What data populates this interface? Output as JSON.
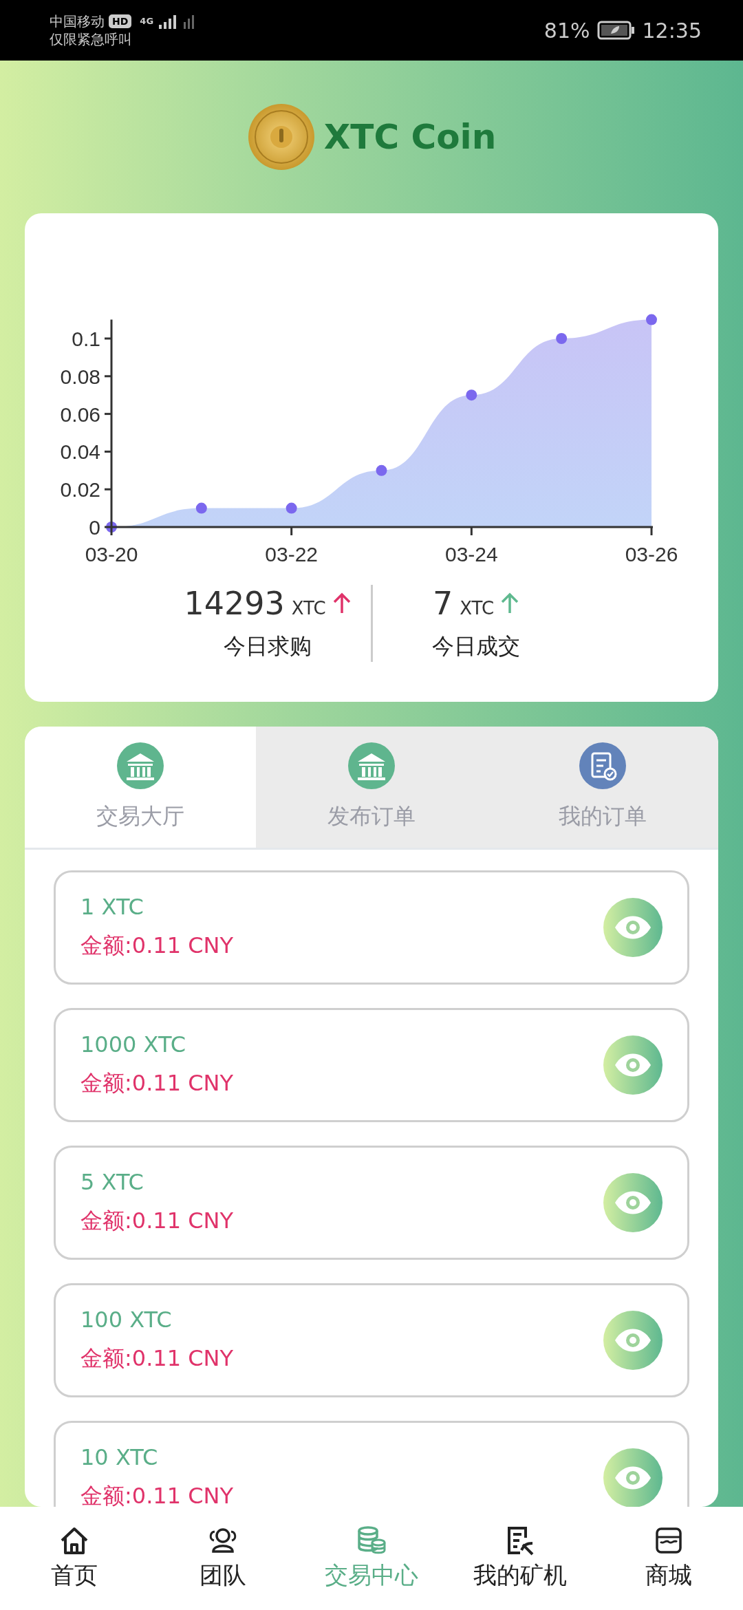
{
  "status_bar": {
    "carrier": "中国移动",
    "hd": "HD",
    "network": "4G",
    "emergency": "仅限紧急呼叫",
    "battery": "81%",
    "time": "12:35"
  },
  "header": {
    "title": "XTC Coin"
  },
  "chart": {
    "chart_data": {
      "type": "area",
      "categories": [
        "03-20",
        null,
        "03-22",
        null,
        "03-24",
        null,
        "03-26"
      ],
      "series": [
        {
          "color": "#7b68ee",
          "values": [
            0,
            0.01,
            0.01,
            0.03,
            0.07,
            0.1,
            0.11
          ]
        }
      ],
      "yticks": [
        {
          "value": 0,
          "label": "0"
        },
        {
          "value": 0.02,
          "label": "0.02"
        },
        {
          "value": 0.04,
          "label": "0.04"
        },
        {
          "value": 0.06,
          "label": "0.06"
        },
        {
          "value": 0.08,
          "label": "0.08"
        },
        {
          "value": 0.1,
          "label": "0.1"
        }
      ],
      "ylim": [
        0,
        0.11
      ]
    }
  },
  "stats": [
    {
      "value": "14293",
      "unit": "XTC",
      "label": "今日求购",
      "color": "#e0336a"
    },
    {
      "value": "7",
      "unit": "XTC",
      "label": "今日成交",
      "color": "#5fb98f"
    }
  ],
  "tabs": [
    {
      "label": "交易大厅",
      "selected": true,
      "kind": "bank",
      "color": "#5fb58e"
    },
    {
      "label": "发布订单",
      "selected": false,
      "kind": "bank",
      "color": "#5fb58e"
    },
    {
      "label": "我的订单",
      "selected": false,
      "kind": "document",
      "color": "#6283ba"
    }
  ],
  "orders": [
    {
      "amount": "1 XTC",
      "price": "金额:0.11 CNY"
    },
    {
      "amount": "1000 XTC",
      "price": "金额:0.11 CNY"
    },
    {
      "amount": "5 XTC",
      "price": "金额:0.11 CNY"
    },
    {
      "amount": "100 XTC",
      "price": "金额:0.11 CNY"
    },
    {
      "amount": "10 XTC",
      "price": "金额:0.11 CNY"
    }
  ],
  "nav": [
    {
      "label": "首页",
      "selected": false,
      "kind": "home"
    },
    {
      "label": "团队",
      "selected": false,
      "kind": "team"
    },
    {
      "label": "交易中心",
      "selected": true,
      "kind": "coins"
    },
    {
      "label": "我的矿机",
      "selected": false,
      "kind": "miner"
    },
    {
      "label": "商城",
      "selected": false,
      "kind": "shop"
    }
  ]
}
